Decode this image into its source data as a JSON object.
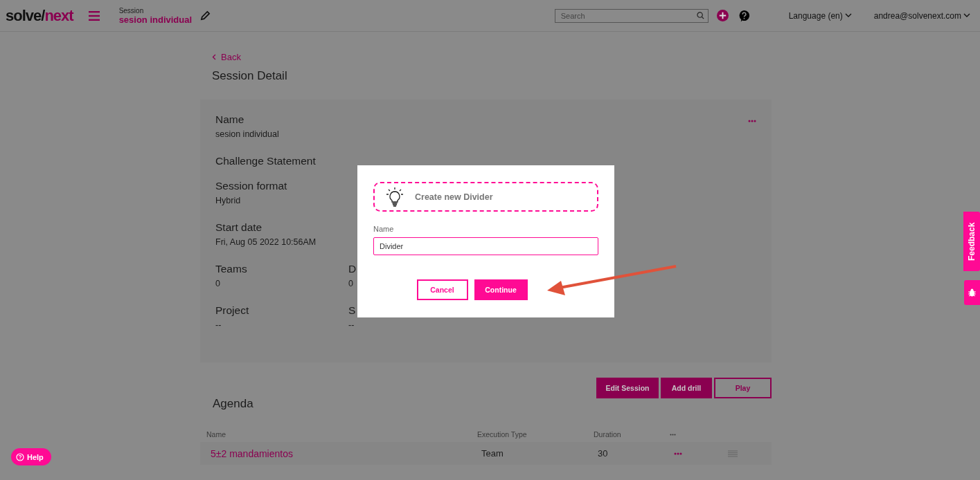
{
  "header": {
    "logo": {
      "first": "solve/",
      "second": "next"
    },
    "context_label": "Session",
    "context_title": "sesion individual",
    "search": {
      "placeholder": "Search"
    },
    "language": "Language (en)",
    "user": "andrea@solvenext.com"
  },
  "page": {
    "back": "Back",
    "title": "Session Detail",
    "fields": [
      {
        "label": "Name",
        "value": "sesion individual"
      },
      {
        "label": "Challenge Statement"
      },
      {
        "label": "Session format",
        "value": "Hybrid"
      },
      {
        "label": "Start date",
        "value": "Fri, Aug 05 2022 10:56AM"
      },
      {
        "label": "Teams",
        "value": "0",
        "column_2": {
          "label": "D",
          "value": "0"
        }
      },
      {
        "label": "Project",
        "value": "--",
        "column_2": {
          "label": "S",
          "value": "--"
        }
      }
    ],
    "actions": [
      {
        "label": "Edit Session",
        "kind": "filled"
      },
      {
        "label": "Add drill",
        "kind": "filled"
      },
      {
        "label": "Play",
        "kind": "outline"
      }
    ],
    "agenda": {
      "title": "Agenda",
      "columns": [
        "Name",
        "Execution Type",
        "Duration"
      ],
      "rows": [
        {
          "name": "5±2 mandamientos",
          "execution_type": "Team",
          "duration": "30"
        }
      ]
    }
  },
  "dialog": {
    "heading": "Create new Divider",
    "field_label": "Name",
    "field_value": "Divider",
    "buttons": [
      {
        "label": "Cancel",
        "kind": "outline"
      },
      {
        "label": "Continue",
        "kind": "filled"
      }
    ]
  },
  "feedback": "Feedback",
  "help": "Help"
}
